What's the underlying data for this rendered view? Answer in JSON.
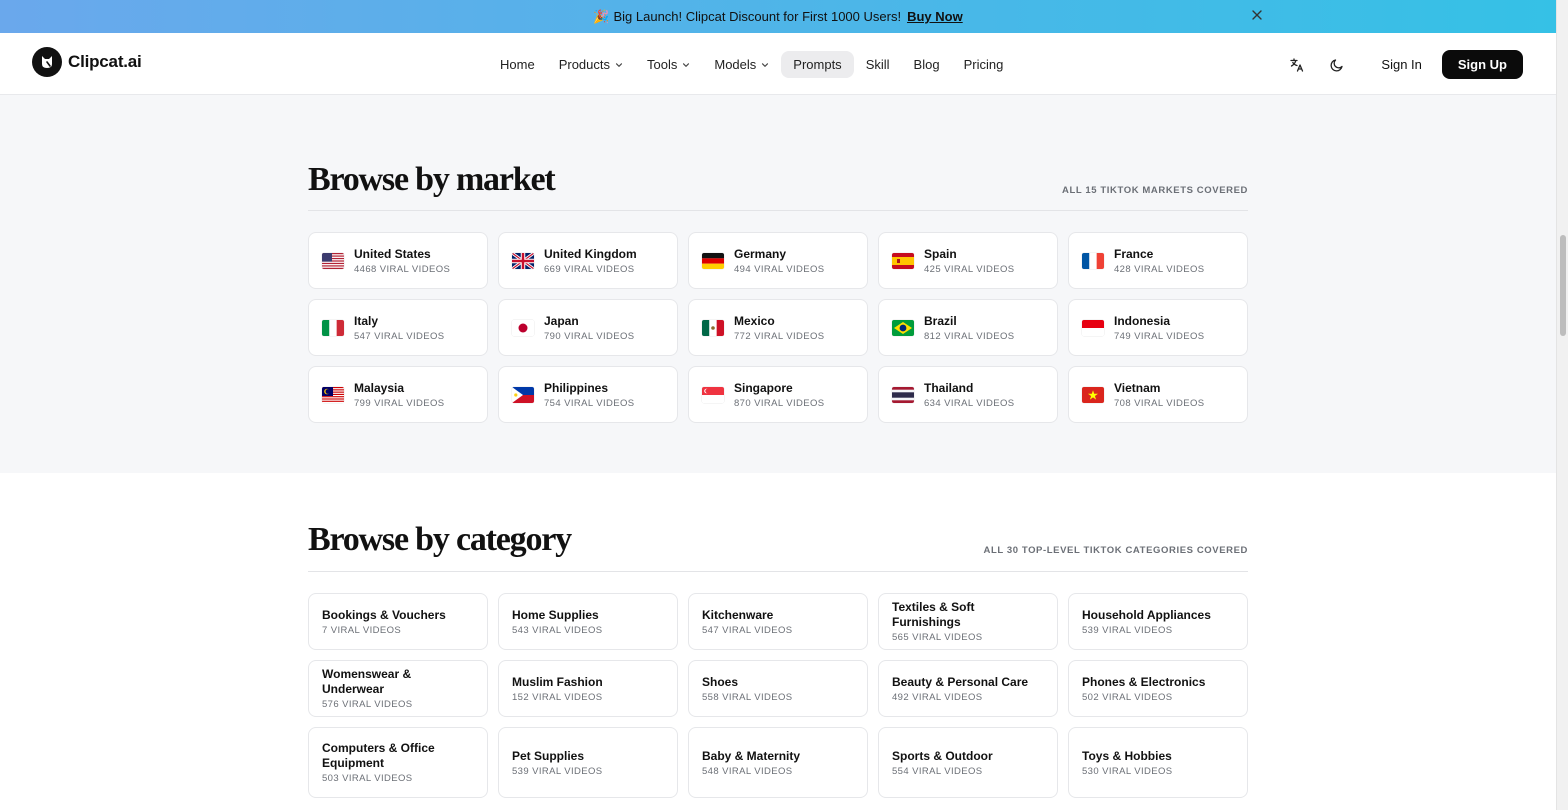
{
  "banner": {
    "emoji": "🎉",
    "text": "Big Launch! Clipcat Discount for First 1000 Users!",
    "cta": "Buy Now"
  },
  "header": {
    "logo": "Clipcat.ai",
    "nav": [
      {
        "label": "Home",
        "dropdown": false
      },
      {
        "label": "Products",
        "dropdown": true
      },
      {
        "label": "Tools",
        "dropdown": true
      },
      {
        "label": "Models",
        "dropdown": true
      },
      {
        "label": "Prompts",
        "dropdown": false,
        "active": true
      },
      {
        "label": "Skill",
        "dropdown": false
      },
      {
        "label": "Blog",
        "dropdown": false
      },
      {
        "label": "Pricing",
        "dropdown": false
      }
    ],
    "icons": [
      "translate-icon",
      "moon-icon"
    ],
    "sign_in": "Sign In",
    "sign_up": "Sign Up"
  },
  "market": {
    "title": "Browse by market",
    "meta": "ALL 15 TIKTOK MARKETS COVERED",
    "items": [
      {
        "name": "United States",
        "count": "4468 VIRAL VIDEOS",
        "flag": "us"
      },
      {
        "name": "United Kingdom",
        "count": "669 VIRAL VIDEOS",
        "flag": "gb"
      },
      {
        "name": "Germany",
        "count": "494 VIRAL VIDEOS",
        "flag": "de"
      },
      {
        "name": "Spain",
        "count": "425 VIRAL VIDEOS",
        "flag": "es"
      },
      {
        "name": "France",
        "count": "428 VIRAL VIDEOS",
        "flag": "fr"
      },
      {
        "name": "Italy",
        "count": "547 VIRAL VIDEOS",
        "flag": "it"
      },
      {
        "name": "Japan",
        "count": "790 VIRAL VIDEOS",
        "flag": "jp"
      },
      {
        "name": "Mexico",
        "count": "772 VIRAL VIDEOS",
        "flag": "mx"
      },
      {
        "name": "Brazil",
        "count": "812 VIRAL VIDEOS",
        "flag": "br"
      },
      {
        "name": "Indonesia",
        "count": "749 VIRAL VIDEOS",
        "flag": "id"
      },
      {
        "name": "Malaysia",
        "count": "799 VIRAL VIDEOS",
        "flag": "my"
      },
      {
        "name": "Philippines",
        "count": "754 VIRAL VIDEOS",
        "flag": "ph"
      },
      {
        "name": "Singapore",
        "count": "870 VIRAL VIDEOS",
        "flag": "sg"
      },
      {
        "name": "Thailand",
        "count": "634 VIRAL VIDEOS",
        "flag": "th"
      },
      {
        "name": "Vietnam",
        "count": "708 VIRAL VIDEOS",
        "flag": "vn"
      }
    ]
  },
  "category": {
    "title": "Browse by category",
    "meta": "ALL 30 TOP-LEVEL TIKTOK CATEGORIES COVERED",
    "items": [
      {
        "name": "Bookings & Vouchers",
        "count": "7 VIRAL VIDEOS"
      },
      {
        "name": "Home Supplies",
        "count": "543 VIRAL VIDEOS"
      },
      {
        "name": "Kitchenware",
        "count": "547 VIRAL VIDEOS"
      },
      {
        "name": "Textiles & Soft Furnishings",
        "count": "565 VIRAL VIDEOS"
      },
      {
        "name": "Household Appliances",
        "count": "539 VIRAL VIDEOS"
      },
      {
        "name": "Womenswear & Underwear",
        "count": "576 VIRAL VIDEOS"
      },
      {
        "name": "Muslim Fashion",
        "count": "152 VIRAL VIDEOS"
      },
      {
        "name": "Shoes",
        "count": "558 VIRAL VIDEOS"
      },
      {
        "name": "Beauty & Personal Care",
        "count": "492 VIRAL VIDEOS"
      },
      {
        "name": "Phones & Electronics",
        "count": "502 VIRAL VIDEOS"
      },
      {
        "name": "Computers & Office Equipment",
        "count": "503 VIRAL VIDEOS"
      },
      {
        "name": "Pet Supplies",
        "count": "539 VIRAL VIDEOS"
      },
      {
        "name": "Baby & Maternity",
        "count": "548 VIRAL VIDEOS"
      },
      {
        "name": "Sports & Outdoor",
        "count": "554 VIRAL VIDEOS"
      },
      {
        "name": "Toys & Hobbies",
        "count": "530 VIRAL VIDEOS"
      }
    ]
  }
}
